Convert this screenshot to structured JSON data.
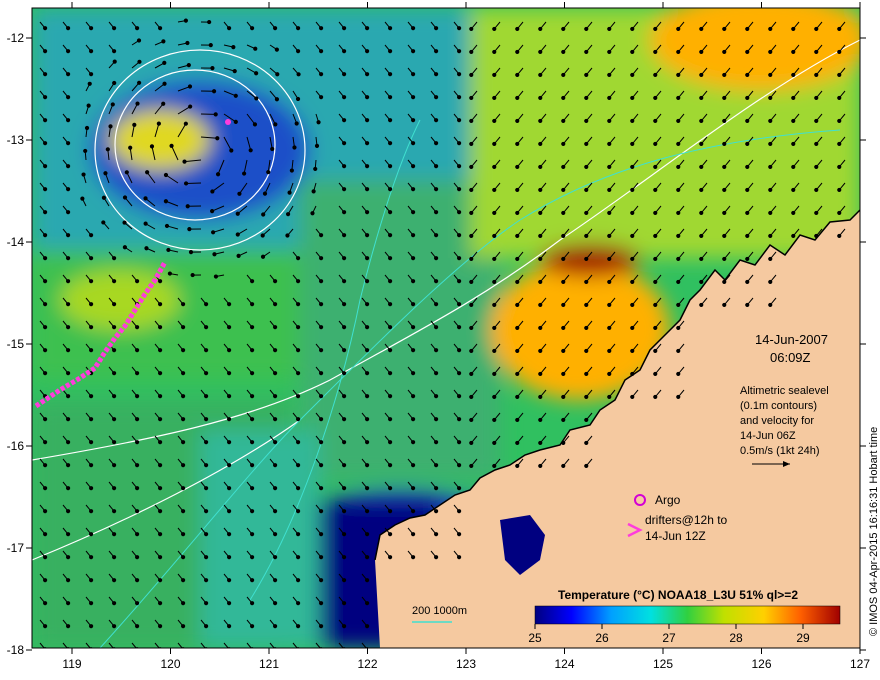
{
  "map": {
    "lon_ticks": [
      "119",
      "120",
      "121",
      "122",
      "123",
      "124",
      "125",
      "126",
      "127"
    ],
    "lat_ticks": [
      "-12",
      "-13",
      "-14",
      "-15",
      "-16",
      "-17",
      "-18"
    ],
    "date": "14-Jun-2007",
    "time": "06:09Z",
    "altimetry_lines": [
      "Altimetric sealevel",
      "(0.1m contours)",
      "and velocity for",
      "14-Jun 06Z",
      "0.5m/s (1kt 24h)"
    ],
    "argo_label": "Argo",
    "drifters_lines": [
      "drifters@12h to",
      "14-Jun 12Z"
    ],
    "depth_scale": "200  1000m",
    "colorbar_title": "Temperature (°C) NOAA18_L3U 51% ql>=2",
    "colorbar_ticks": [
      "25",
      "26",
      "27",
      "28",
      "29"
    ],
    "credit": "© IMOS 04-Apr-2015 16:16:31 Hobart time"
  },
  "colors": {
    "land": "#f5c9a0",
    "cold": "#000080",
    "warm": "#8b0000",
    "drifter": "#ff3cdc",
    "argo": "#d400d4",
    "isobath": "#40e0d0"
  },
  "icons": [
    "argo-circle-icon",
    "drifter-chevron-icon",
    "velocity-scale-arrow-icon"
  ]
}
